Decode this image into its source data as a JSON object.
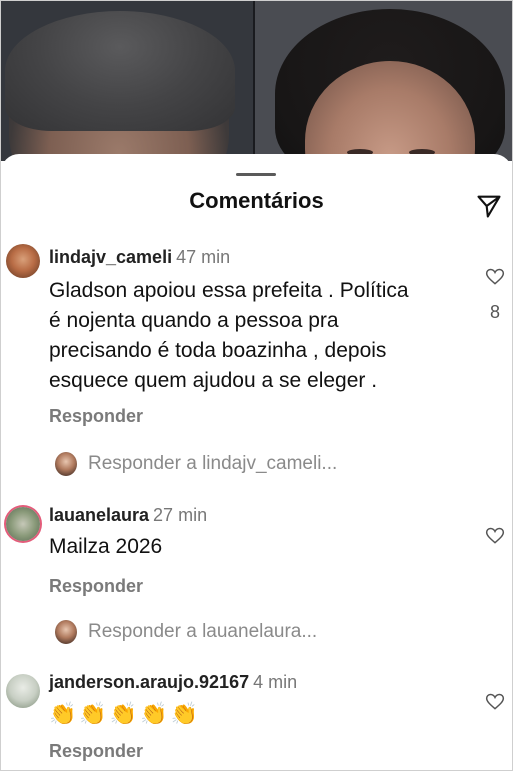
{
  "sheet": {
    "title": "Comentários"
  },
  "icons": {
    "send": "send-icon",
    "heart": "heart-outline-icon"
  },
  "colors": {
    "username": "#222222",
    "meta": "#777777",
    "reply": "#7a7a7a",
    "story_ring": "#e35c7a"
  },
  "comments": [
    {
      "username": "lindajv_cameli",
      "time": "47 min",
      "lines": [
        "Gladson apoiou essa prefeita . Política",
        "é nojenta quando a pessoa pra",
        "precisando é toda boazinha , depois",
        "esquece quem ajudou a se eleger ."
      ],
      "reply_label": "Responder",
      "likes": "8",
      "reply_prompt": "Responder a lindajv_cameli..."
    },
    {
      "username": "lauanelaura",
      "time": "27 min",
      "lines": [
        "Mailza 2026"
      ],
      "reply_label": "Responder",
      "reply_prompt": "Responder a lauanelaura..."
    },
    {
      "username": "janderson.araujo.92167",
      "time": "4 min",
      "emojis": "👏👏👏👏👏",
      "reply_label": "Responder"
    }
  ]
}
